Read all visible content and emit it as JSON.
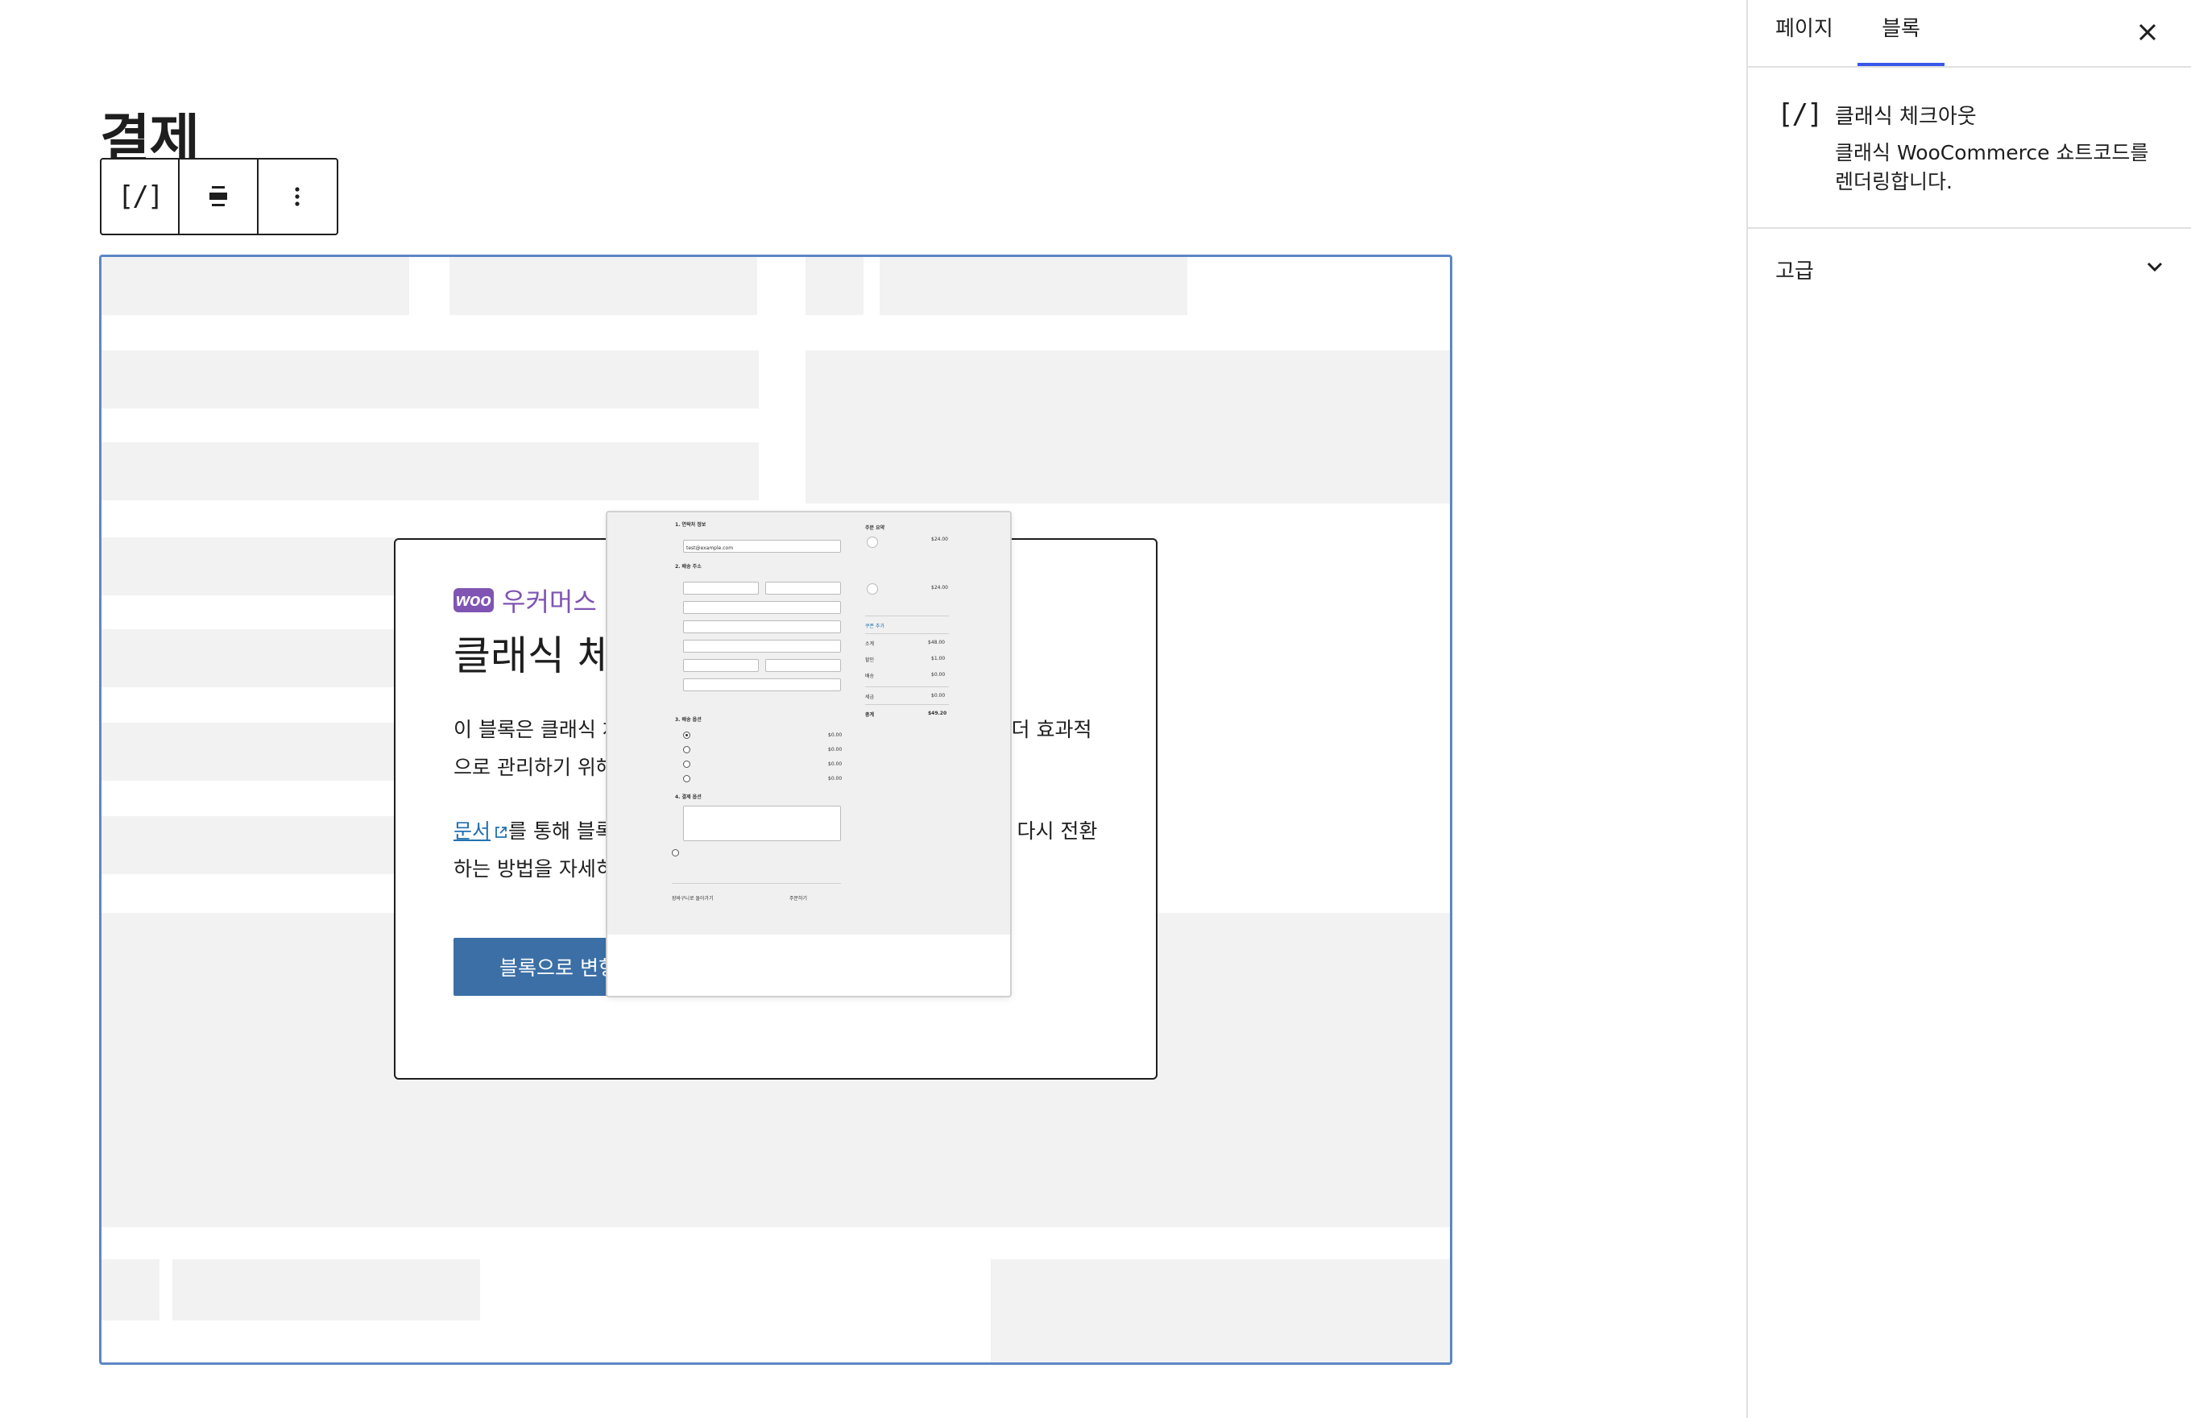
{
  "editor": {
    "page_title": "결제",
    "toolbar": {
      "shortcode_icon": "[/]",
      "align_icon": "align-center-icon",
      "more_icon": "more-vertical-icon"
    }
  },
  "placeholder": {
    "brand_logo": "woo",
    "brand_name": "우커머스",
    "title": "클래식 체",
    "description": "이 블록은 클래식 체크아웃 숏코드를 렌더링합니다. 결제 페이지를 더 효과적으로 관리하기 위해 블록으로 변형할 수 있습니다.",
    "docs_link": "문서",
    "docs_text": "를 통해 블록 기반 결제 페이지에 대해 알아보고 필요한 경우 다시 전환하는 방법을 자세히 확인하세요.",
    "transform_button": "블록으로 변형"
  },
  "preview": {
    "sections": [
      "1. 연락처 정보",
      "2. 배송 주소",
      "3. 배송 옵션",
      "4. 결제 옵션"
    ],
    "email_value": "test@example.com",
    "summary_title": "주문 요약",
    "items": [
      {
        "price": "$24.00"
      },
      {
        "price": "$24.00"
      }
    ],
    "coupon_link": "쿠폰 추가",
    "subtotal_label": "소계",
    "subtotal": "$48.00",
    "discount_label": "할인",
    "discount": "$1.00",
    "shipping_label": "배송",
    "shipping": "$0.00",
    "tax_label": "세금",
    "tax": "$0.00",
    "total_label": "총계",
    "total": "$49.20",
    "shipping_options": [
      {
        "price": "$0.00",
        "selected": true
      },
      {
        "price": "$0.00",
        "selected": false
      },
      {
        "price": "$0.00",
        "selected": false
      },
      {
        "price": "$0.00",
        "selected": false
      }
    ],
    "back_link": "장바구니로 돌아가기",
    "place_order": "주문하기"
  },
  "sidebar": {
    "tabs": [
      "페이지",
      "블록"
    ],
    "active_tab": "블록",
    "close_icon": "close-icon",
    "block_card": {
      "icon": "[/]",
      "title": "클래식 체크아웃",
      "description": "클래식 WooCommerce 쇼트코드를 렌더링합니다."
    },
    "advanced": {
      "title": "고급",
      "icon": "chevron-down-icon"
    }
  },
  "colors": {
    "selection": "#5c87c4",
    "woo_purple": "#7f54b3",
    "button_blue": "#3b6fa6",
    "link_blue": "#2271b1",
    "tab_accent": "#3858e9",
    "skeleton": "#f2f2f2"
  }
}
